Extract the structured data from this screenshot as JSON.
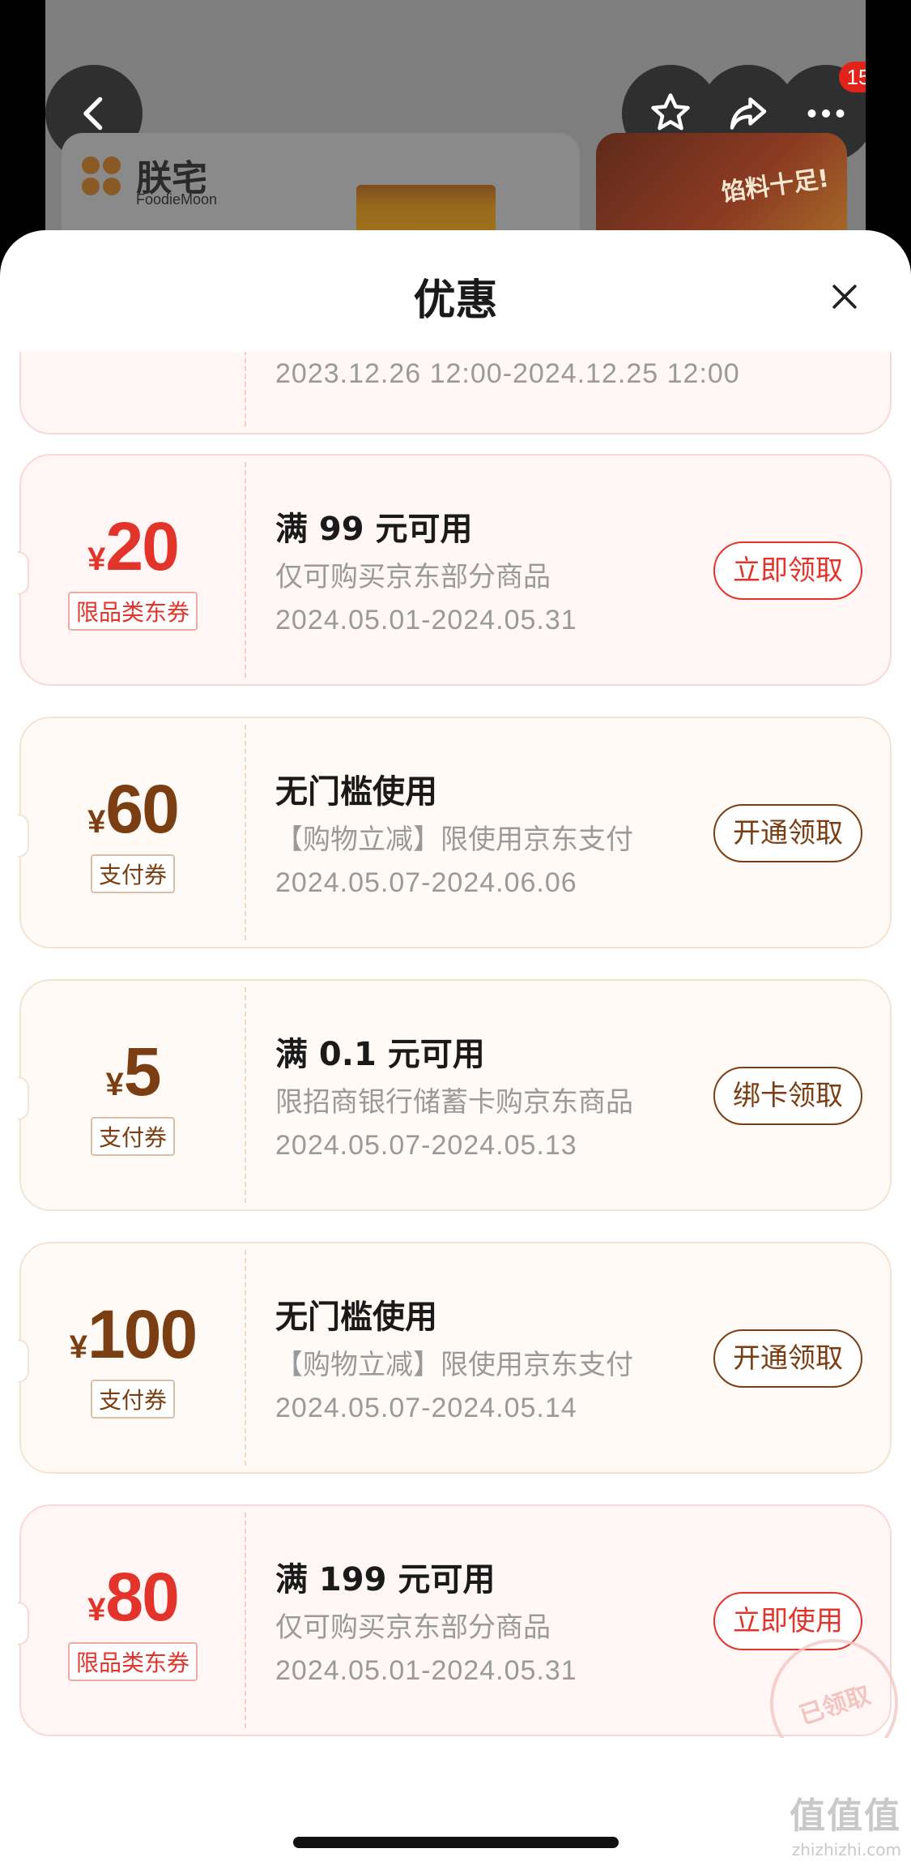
{
  "background": {
    "notification_count": "15",
    "brand_name": "朕宅",
    "brand_sub": "FoodieMoon",
    "thumb_text": "馅料十足!"
  },
  "sheet": {
    "title": "优惠"
  },
  "partial_coupon": {
    "date": "2023.12.26 12:00-2024.12.25 12:00"
  },
  "coupons": [
    {
      "style": "red",
      "currency": "¥",
      "amount": "20",
      "type_tag": "限品类东券",
      "condition": "满 99 元可用",
      "description": "仅可购买京东部分商品",
      "date": "2024.05.01-2024.05.31",
      "action": "立即领取"
    },
    {
      "style": "brown",
      "currency": "¥",
      "amount": "60",
      "type_tag": "支付券",
      "condition": "无门槛使用",
      "description": "【购物立减】限使用京东支付",
      "date": "2024.05.07-2024.06.06",
      "action": "开通领取"
    },
    {
      "style": "brown",
      "currency": "¥",
      "amount": "5",
      "type_tag": "支付券",
      "condition": "满 0.1 元可用",
      "description": "限招商银行储蓄卡购京东商品",
      "date": "2024.05.07-2024.05.13",
      "action": "绑卡领取"
    },
    {
      "style": "brown",
      "currency": "¥",
      "amount": "100",
      "type_tag": "支付券",
      "condition": "无门槛使用",
      "description": "【购物立减】限使用京东支付",
      "date": "2024.05.07-2024.05.14",
      "action": "开通领取"
    },
    {
      "style": "red",
      "currency": "¥",
      "amount": "80",
      "type_tag": "限品类东券",
      "condition": "满 199 元可用",
      "description": "仅可购买京东部分商品",
      "date": "2024.05.01-2024.05.31",
      "action": "立即使用",
      "stamp": "已领取"
    }
  ],
  "watermark": {
    "text": "值值值",
    "url": "zhizhizhi.com"
  },
  "colors": {
    "accent_red": "#e3342b",
    "accent_brown": "#7a3e12"
  }
}
